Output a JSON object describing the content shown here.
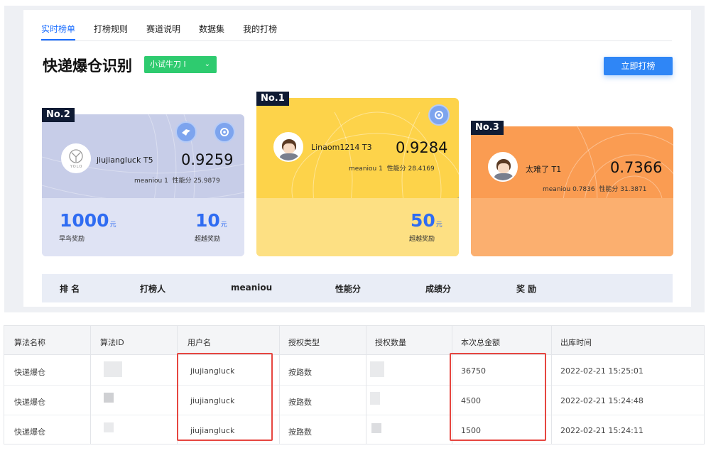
{
  "tabs": [
    "实时榜单",
    "打榜规则",
    "赛道说明",
    "数据集",
    "我的打榜"
  ],
  "page_title": "快递爆仓识别",
  "level_select": {
    "value": "小试牛刀 I"
  },
  "join_button": "立即打榜",
  "podium": [
    {
      "rank": "No.2",
      "user": "jiujiangluck",
      "tier": "T5",
      "score": "0.9259",
      "meaniou_label": "meaniou",
      "meaniou": "1",
      "perf_label": "性能分",
      "perf": "25.9879",
      "prizes": [
        {
          "amount": "1000",
          "unit": "元",
          "label": "早鸟奖励"
        },
        {
          "amount": "10",
          "unit": "元",
          "label": "超越奖励"
        }
      ]
    },
    {
      "rank": "No.1",
      "user": "Linaom1214",
      "tier": "T3",
      "score": "0.9284",
      "meaniou_label": "meaniou",
      "meaniou": "1",
      "perf_label": "性能分",
      "perf": "28.4169",
      "prizes": [
        {
          "amount": "50",
          "unit": "元",
          "label": "超越奖励"
        }
      ]
    },
    {
      "rank": "No.3",
      "user": "太难了",
      "tier": "T1",
      "score": "0.7366",
      "meaniou_label": "meaniou",
      "meaniou": "0.7836",
      "perf_label": "性能分",
      "perf": "31.3871"
    }
  ],
  "avatar_logo_text": "YOLO",
  "ranking_headers": [
    "排 名",
    "打榜人",
    "meaniou",
    "性能分",
    "成绩分",
    "奖 励"
  ],
  "table": {
    "headers": [
      "算法名称",
      "算法ID",
      "用户名",
      "授权类型",
      "授权数量",
      "本次总金额",
      "出库时间"
    ],
    "rows": [
      [
        "快递爆仓",
        "",
        "jiujiangluck",
        "按路数",
        "",
        "36750",
        "2022-02-21 15:25:01"
      ],
      [
        "快递爆仓",
        "",
        "jiujiangluck",
        "按路数",
        "",
        "4500",
        "2022-02-21 15:24:48"
      ],
      [
        "快递爆仓",
        "",
        "jiujiangluck",
        "按路数",
        "",
        "1500",
        "2022-02-21 15:24:11"
      ]
    ]
  },
  "colors": {
    "accent": "#1a6dff",
    "green": "#2ecb6f",
    "gold": "#fdd34a",
    "silver": "#c7cde8",
    "bronze": "#fa9c52",
    "highlight": "#e64640"
  }
}
